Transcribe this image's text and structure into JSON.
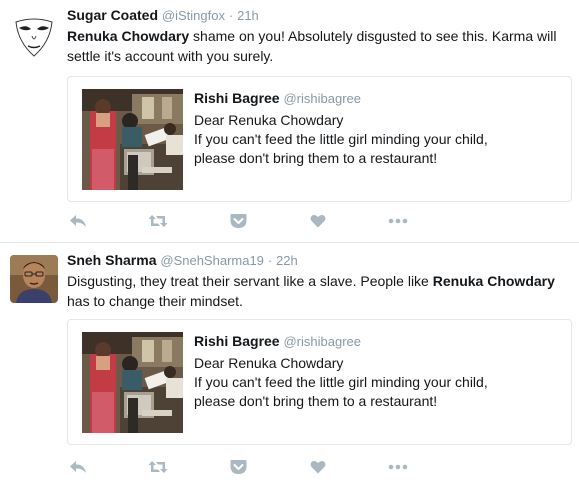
{
  "colors": {
    "name": "#14171a",
    "meta": "#8899a6",
    "icon": "#aab8c2",
    "border": "#e1e8ed"
  },
  "tweets": [
    {
      "name": "Sugar Coated",
      "handle": "@iStingfox",
      "dot": "·",
      "time": "21h",
      "text_mention": "Renuka Chowdary",
      "text_rest": " shame on you! Absolutely disgusted to see this. Karma will settle it's account with you surely.",
      "quote": {
        "name": "Rishi Bagree",
        "handle": "@rishibagree",
        "line1": "Dear Renuka Chowdary",
        "line2": "If you can't feed the little girl minding your child,",
        "line3": "please don't bring them to a restaurant!"
      },
      "actions": [
        "reply-icon",
        "retweet-icon",
        "pocket-icon",
        "like-icon",
        "more-icon"
      ]
    },
    {
      "name": "Sneh Sharma",
      "handle": "@SnehSharma19",
      "dot": "·",
      "time": "22h",
      "text_start": "Disgusting, they treat their servant like a slave. People like ",
      "text_mention": "Renuka Chowdary",
      "text_rest": " has to change their mindset.",
      "quote": {
        "name": "Rishi Bagree",
        "handle": "@rishibagree",
        "line1": "Dear Renuka Chowdary",
        "line2": "If you can't feed the little girl minding your child,",
        "line3": "please don't bring them to a restaurant!"
      },
      "actions": [
        "reply-icon",
        "retweet-icon",
        "pocket-icon",
        "like-icon",
        "more-icon"
      ]
    }
  ]
}
